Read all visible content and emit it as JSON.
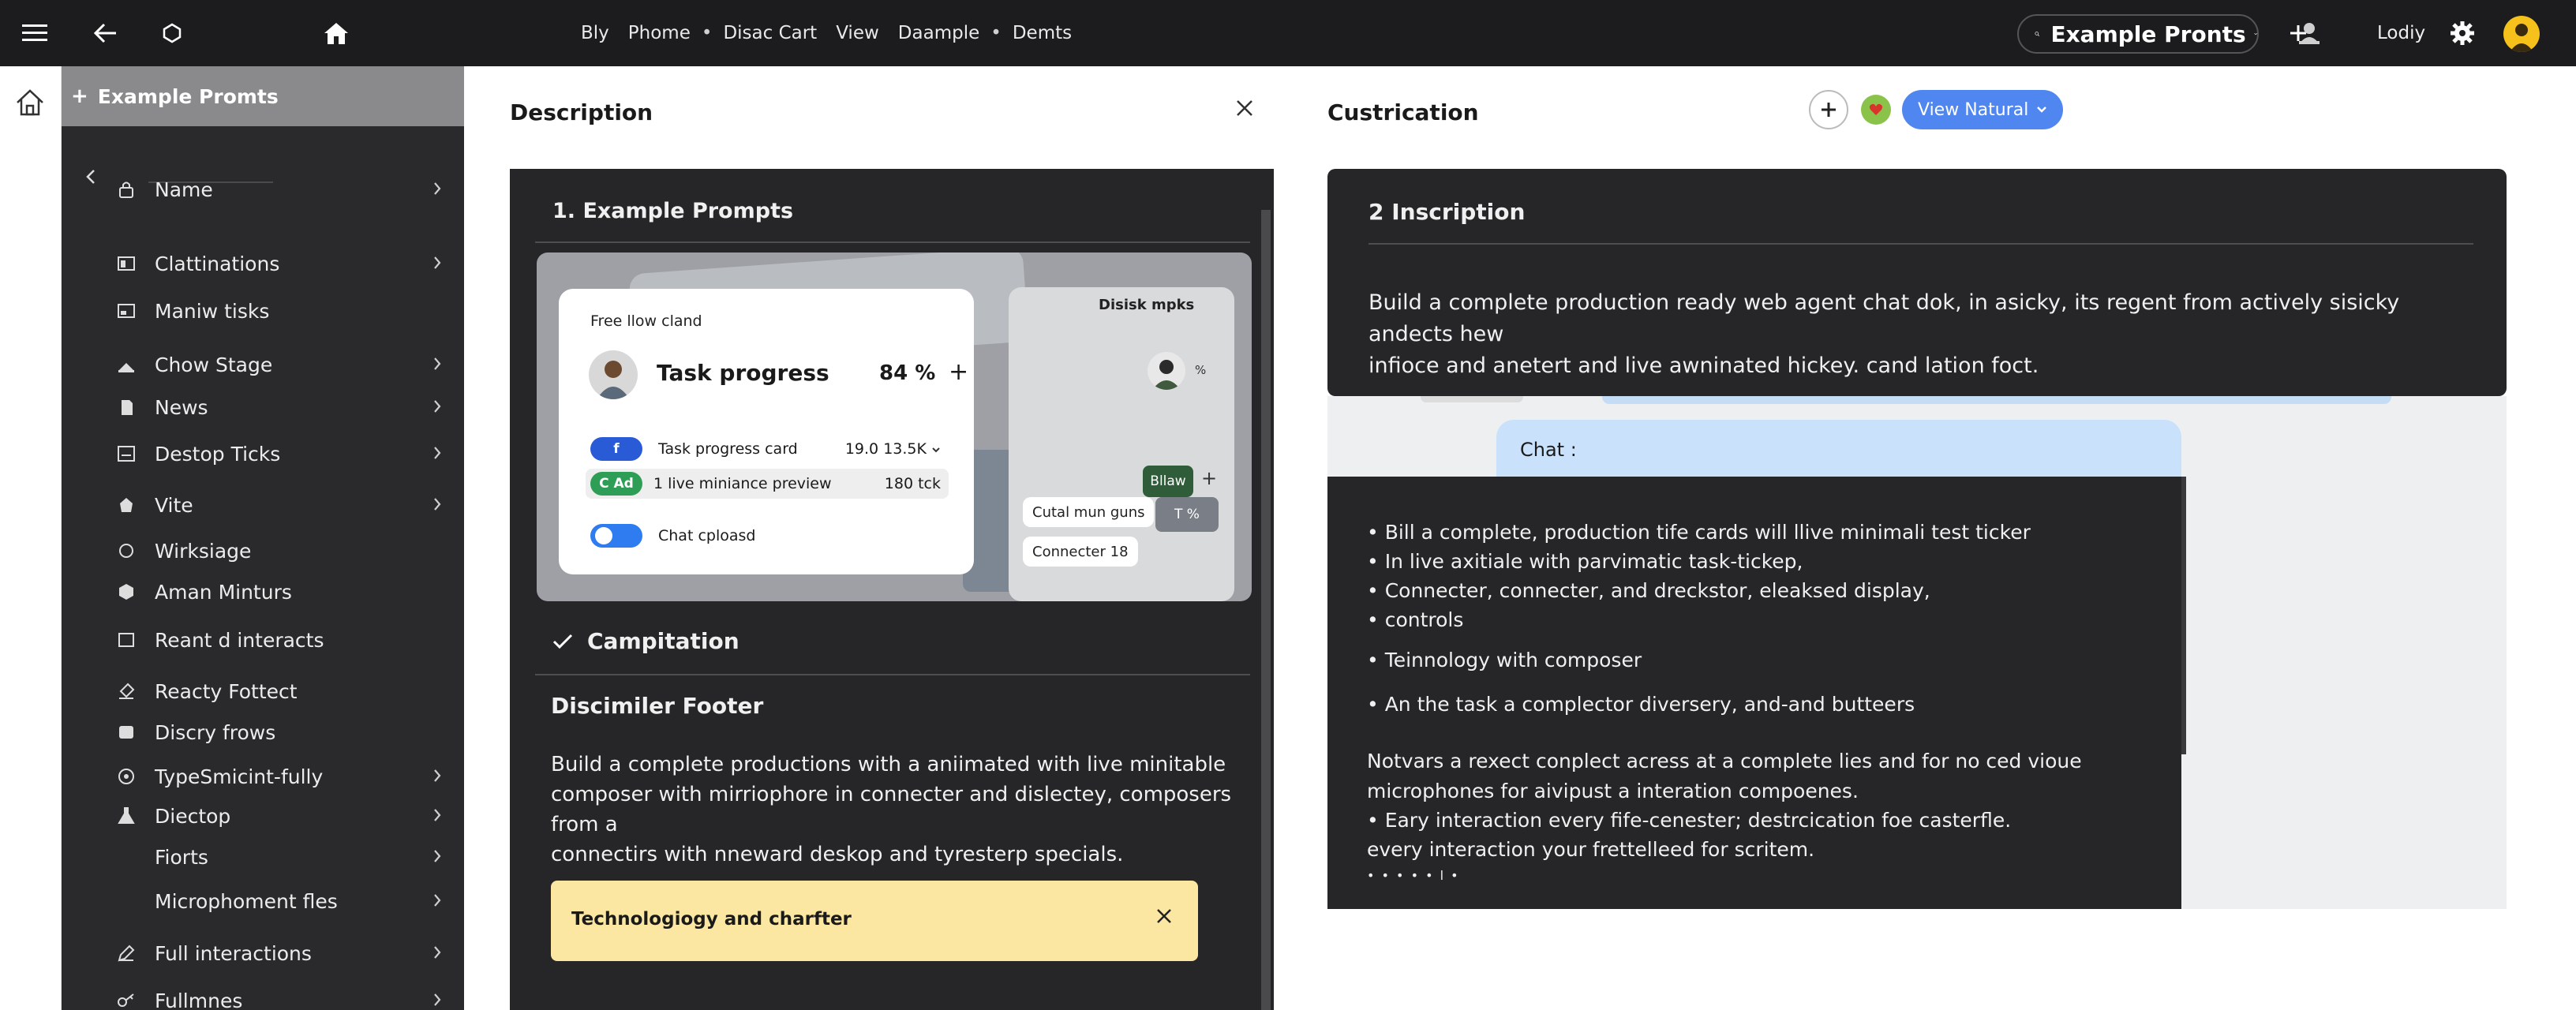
{
  "topbar": {
    "breadcrumbs": [
      "Bly",
      "Phome",
      "Disac Cart",
      "View",
      "Daample",
      "Demts"
    ],
    "search_label": "Example Pronts",
    "user_name": "Lodiy"
  },
  "sidebar": {
    "header": "Example Promts",
    "items": [
      {
        "label": "Name",
        "icon": "lock-icon",
        "chevron": true
      },
      {
        "label": "Clattinations",
        "icon": "columns-icon",
        "chevron": true
      },
      {
        "label": "Maniw tisks",
        "icon": "panel-icon",
        "chevron": false
      },
      {
        "label": "Chow Stage",
        "icon": "stage-icon",
        "chevron": true
      },
      {
        "label": "News",
        "icon": "news-icon",
        "chevron": true
      },
      {
        "label": "Destop Ticks",
        "icon": "desktop-icon",
        "chevron": true
      },
      {
        "label": "Vite",
        "icon": "vite-icon",
        "chevron": true
      },
      {
        "label": "Wirksiage",
        "icon": "circle-icon",
        "chevron": false
      },
      {
        "label": "Aman Minturs",
        "icon": "hexagon-icon",
        "chevron": false
      },
      {
        "label": "Reant d interacts",
        "icon": "square-icon",
        "chevron": false
      },
      {
        "label": "Reacty Fottect",
        "icon": "brush-icon",
        "chevron": false
      },
      {
        "label": "Discry frows",
        "icon": "filled-square-icon",
        "chevron": false
      },
      {
        "label": "TypeSmicint-fully",
        "icon": "clock-icon",
        "chevron": true
      },
      {
        "label": "Diectop",
        "icon": "flask-icon",
        "chevron": true
      },
      {
        "label": "Fiorts",
        "icon": "",
        "chevron": true
      },
      {
        "label": "Microphoment fles",
        "icon": "",
        "chevron": true
      },
      {
        "label": "Full interactions",
        "icon": "pen-icon",
        "chevron": true
      },
      {
        "label": "Fullmnes",
        "icon": "key-icon",
        "chevron": true
      }
    ]
  },
  "center": {
    "pane_title": "Description",
    "card_title": "1.  Example Prompts",
    "preview": {
      "free_label": "Free llow cland",
      "task_title": "Task progress",
      "task_percent": "84 %",
      "task_progress": 84,
      "rows": [
        {
          "badge": "f",
          "label": "Task progress card",
          "value": "19.0  13.5K",
          "badge_color": "#2a5bd7"
        },
        {
          "badge": "C Ad",
          "label": "1 live miniance preview",
          "value": "180 tck",
          "badge_color": "#2e9e57"
        },
        {
          "badge": "",
          "label": "Chat cploasd",
          "value": "",
          "badge_color": "#2f7bf0"
        }
      ],
      "side_title": "Disisk mpks",
      "side_percent": "%",
      "bllaw_label": "Bllaw",
      "chip1": "Cutal mun guns",
      "chip2": "Connecter  18",
      "chip3": "T %"
    },
    "check_label": "Campitation",
    "section_title": "Discimiler Footer",
    "paragraph": [
      "Build a complete productions with a aniimated with live minitable",
      "composer with mirriophore in connecter and dislectey, composers from a",
      "connectirs with nneward deskop and tyresterp specials."
    ],
    "note_label": "Technologiogy and charfter"
  },
  "right": {
    "pane_title": "Custrication",
    "view_label": "View Natural",
    "card_title": "2 Inscription",
    "card_paragraph": [
      "Build a complete production ready web agent chat dok, in asicky, its regent from actively sisicky andects hew",
      "infioce and anetert and live awninated hickey. cand lation foct."
    ],
    "chat_label": "Chat :",
    "bullets": [
      "• Bill a complete, production tife cards will llive minimali test ticker",
      "• In live axitiale with parvimatic task-tickep,",
      "• Connecter, connecter, and dreckstor, eleaksed display,",
      "• controls",
      "•  Teinnology with composer",
      "• An the task a complector diversery, and-and butteers"
    ],
    "closing": [
      "Notvars a rexect conplect acress at a complete lies and for no ced vioue",
      "microphones for aivipust a interation compoenes.",
      "• Eary interaction every fife-cenester; destrcication foe casterfle.",
      "every interaction your frettelleed for scritem.",
      "• • • • • l •"
    ]
  },
  "colors": {
    "topbar": "#1c1c1e",
    "sidebar": "#2a2a2c",
    "card": "#262628",
    "accent_blue": "#4f86f0",
    "note_yellow": "#fbe6a2",
    "avatar_yellow": "#f5c11a"
  }
}
